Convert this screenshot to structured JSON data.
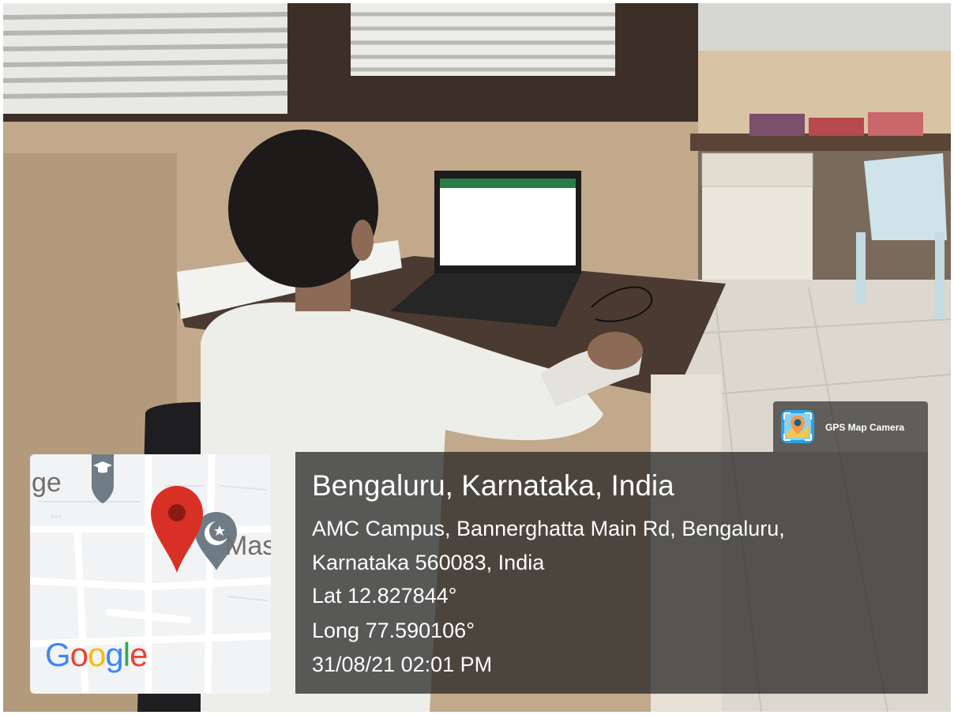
{
  "overlay": {
    "badge_label": "GPS Map Camera",
    "badge_icon": "gps-map-camera-icon",
    "title": "Bengaluru, Karnataka, India",
    "address_line1": "AMC Campus, Bannerghatta Main Rd, Bengaluru,",
    "address_line2": "Karnataka 560083, India",
    "latitude": "Lat 12.827844°",
    "longitude": "Long 77.590106°",
    "datetime": "31/08/21 02:01 PM"
  },
  "map": {
    "label_left": "ge",
    "label_right": "Mas",
    "brand_letters": [
      "G",
      "o",
      "o",
      "g",
      "l",
      "e"
    ],
    "pin_color": "#d93025",
    "icons": [
      "graduation-cap-icon",
      "mosque-icon",
      "location-pin-icon"
    ]
  },
  "colors": {
    "google_blue": "#4285f4",
    "google_red": "#ea4335",
    "google_yellow": "#fbbc05",
    "google_green": "#34a853"
  }
}
